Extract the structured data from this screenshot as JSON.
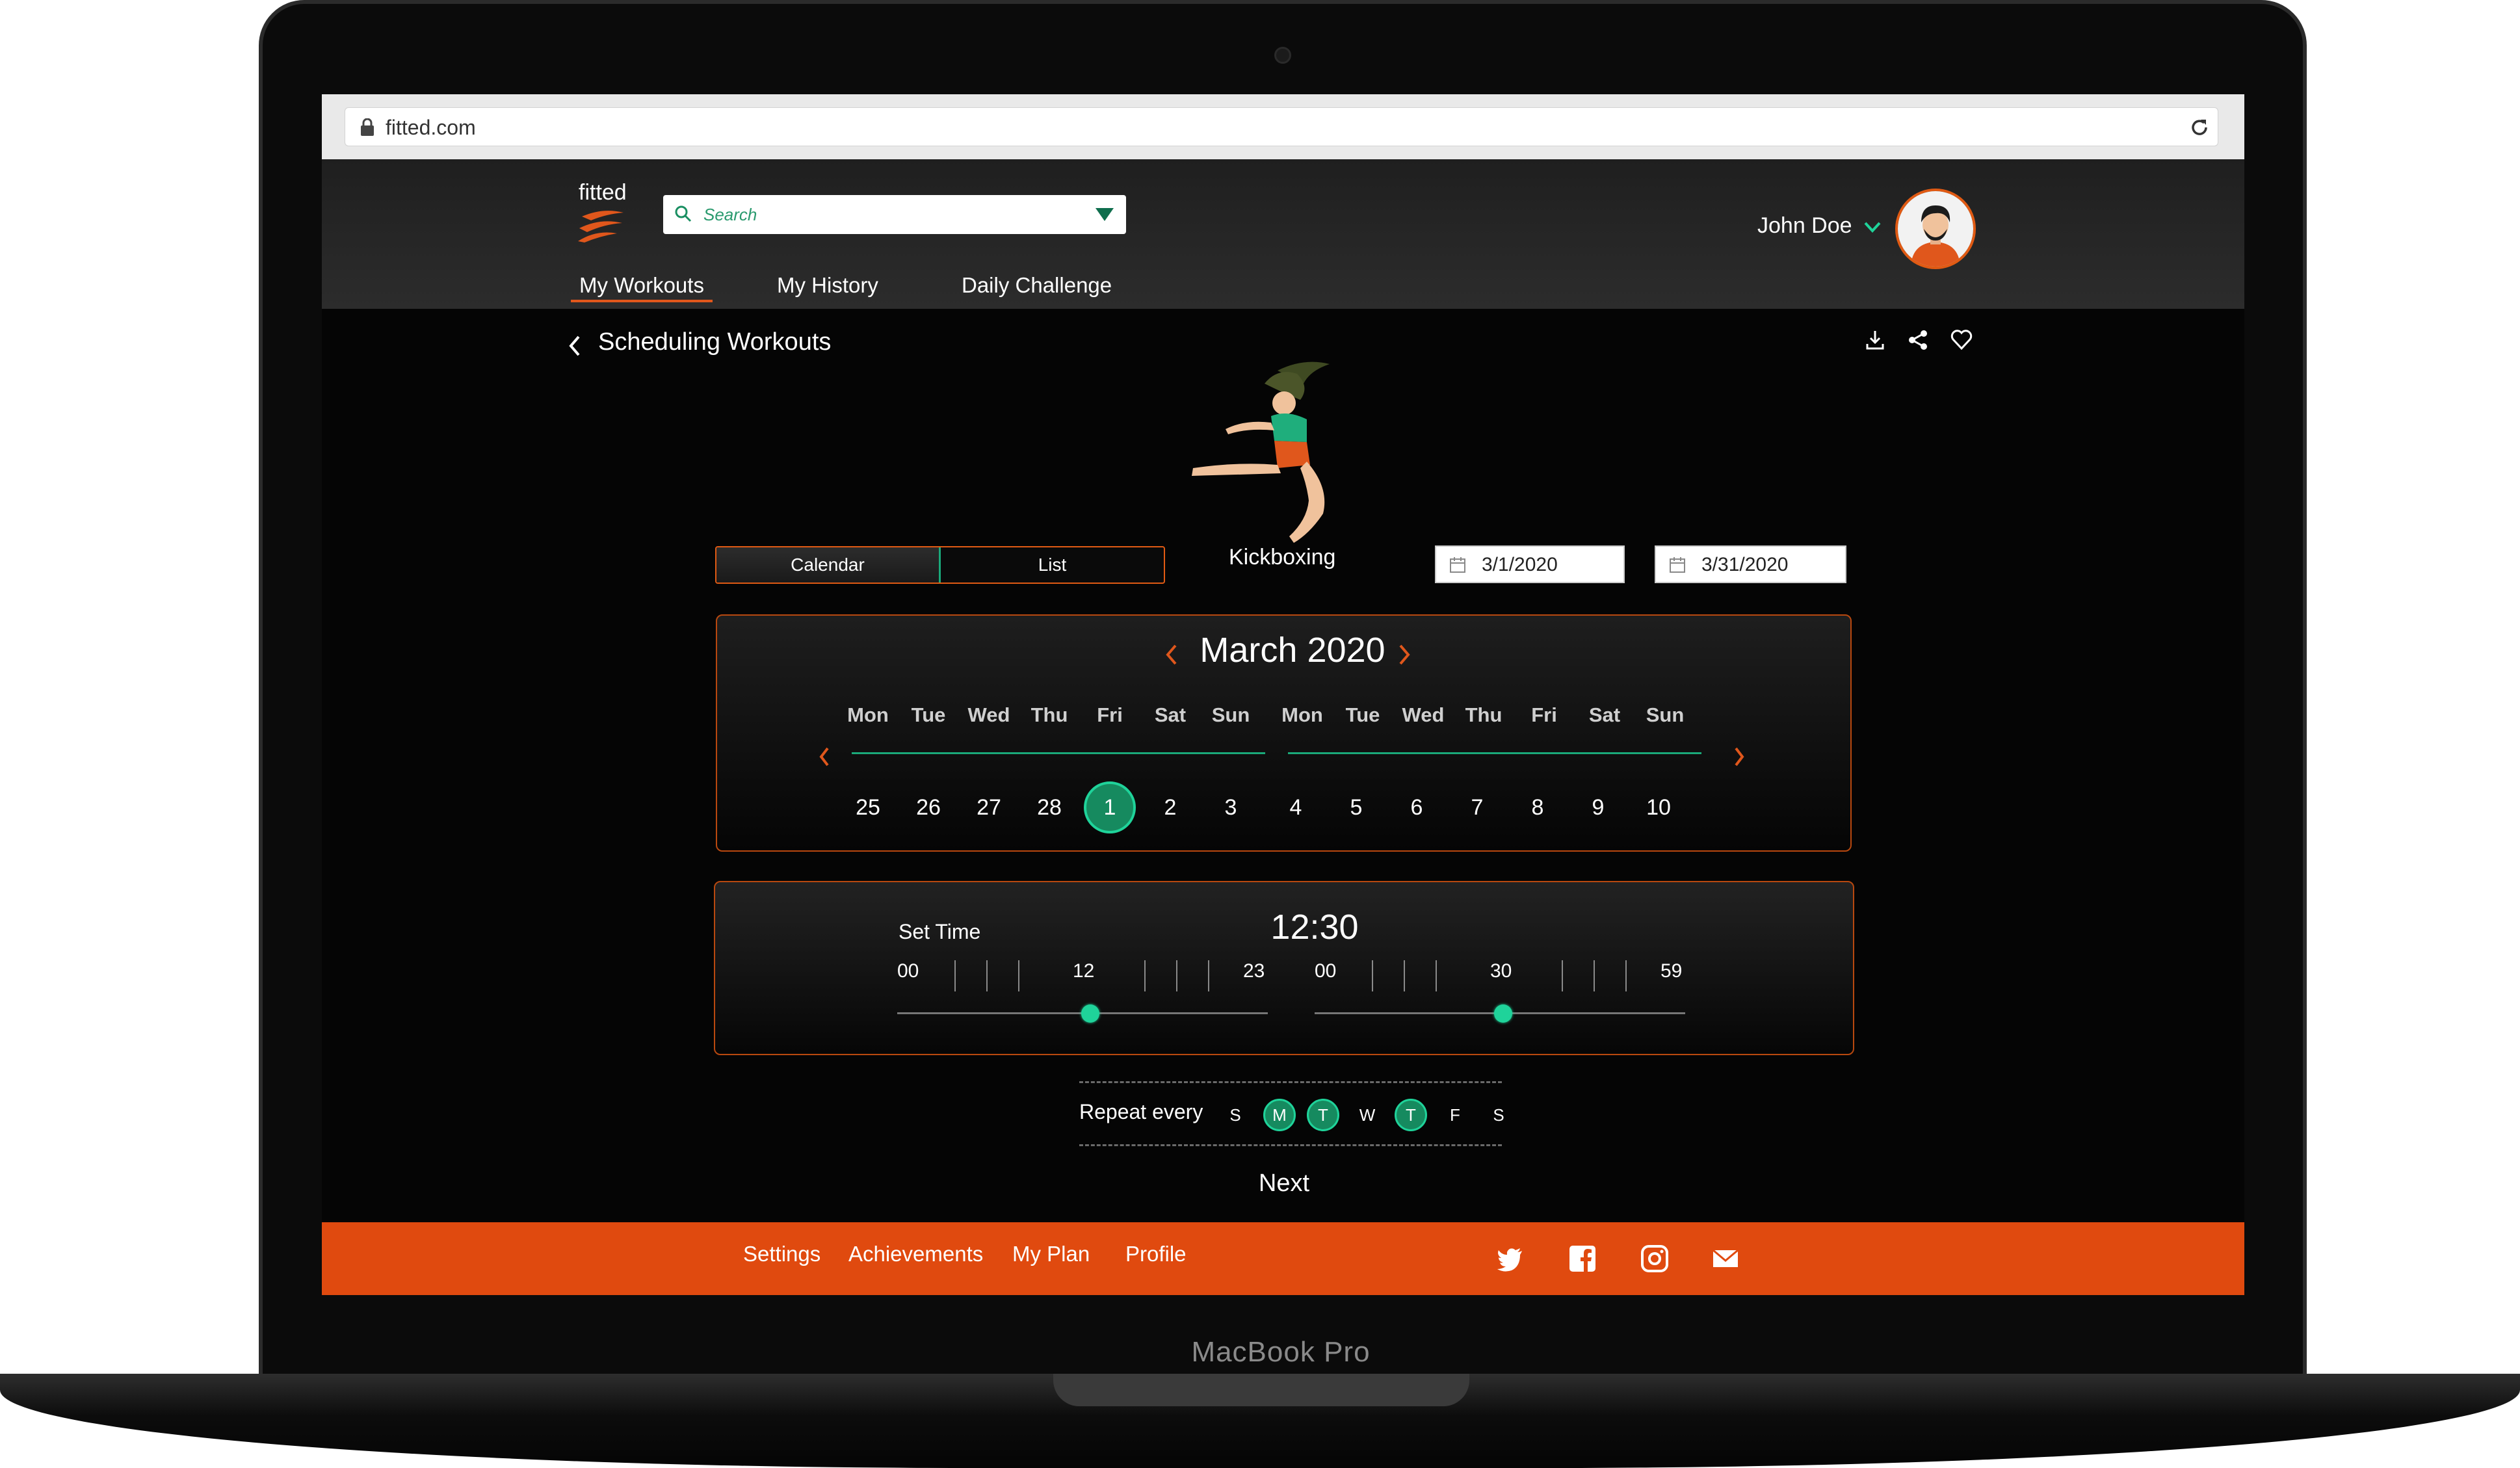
{
  "device": {
    "label": "MacBook Pro"
  },
  "browser": {
    "url": "fitted.com"
  },
  "header": {
    "logo_text": "fitted",
    "search_placeholder": "Search",
    "user_name": "John Doe",
    "tabs": [
      {
        "label": "My Workouts",
        "active": true
      },
      {
        "label": "My History",
        "active": false
      },
      {
        "label": "Daily Challenge",
        "active": false
      }
    ]
  },
  "page": {
    "title": "Scheduling Workouts",
    "workout_name": "Kickboxing",
    "view_toggle": {
      "calendar": "Calendar",
      "list": "List",
      "selected": "Calendar"
    },
    "start_date": "3/1/2020",
    "end_date": "3/31/2020"
  },
  "calendar": {
    "month": "March 2020",
    "weekdays": [
      "Mon",
      "Tue",
      "Wed",
      "Thu",
      "Fri",
      "Sat",
      "Sun",
      "Mon",
      "Tue",
      "Wed",
      "Thu",
      "Fri",
      "Sat",
      "Sun"
    ],
    "days": [
      "25",
      "26",
      "27",
      "28",
      "1",
      "2",
      "3",
      "4",
      "5",
      "6",
      "7",
      "8",
      "9",
      "10"
    ],
    "selected_day": "1"
  },
  "time": {
    "label": "Set Time",
    "display": "12:30",
    "hour_slider": {
      "min_label": "00",
      "mid_label": "12",
      "max_label": "23",
      "value": 12
    },
    "minute_slider": {
      "min_label": "00",
      "mid_label": "30",
      "max_label": "59",
      "value": 30
    }
  },
  "repeat": {
    "label": "Repeat every",
    "days": [
      {
        "label": "S",
        "selected": false
      },
      {
        "label": "M",
        "selected": true
      },
      {
        "label": "T",
        "selected": true
      },
      {
        "label": "W",
        "selected": false
      },
      {
        "label": "T",
        "selected": true
      },
      {
        "label": "F",
        "selected": false
      },
      {
        "label": "S",
        "selected": false
      }
    ]
  },
  "next_label": "Next",
  "footer": {
    "links": [
      "Settings",
      "Achievements",
      "My Plan",
      "Profile"
    ],
    "social": [
      "twitter-icon",
      "facebook-icon",
      "instagram-icon",
      "mail-icon"
    ]
  },
  "colors": {
    "accent": "#e04a0f",
    "green": "#1aa97a",
    "bg": "#050505"
  }
}
